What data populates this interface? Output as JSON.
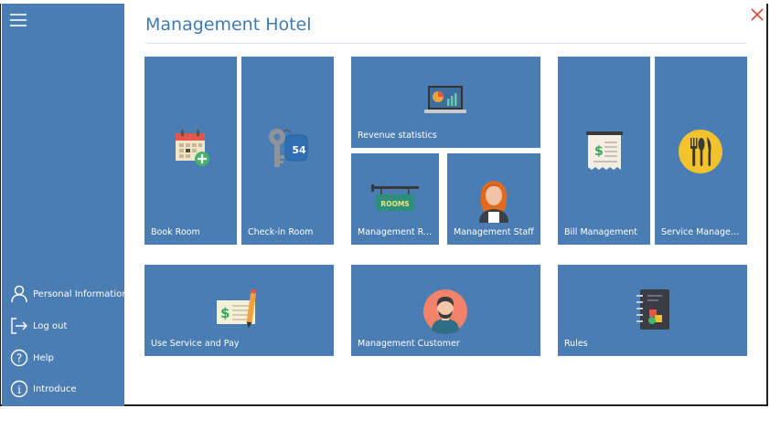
{
  "app": {
    "title": "Management Hotel"
  },
  "sidebar": {
    "menu_icon": "hamburger-icon",
    "items": [
      {
        "label": "Personal Information",
        "icon": "user-icon"
      },
      {
        "label": "Log out",
        "icon": "logout-icon"
      },
      {
        "label": "Help",
        "icon": "help-icon"
      },
      {
        "label": "Introduce",
        "icon": "info-icon"
      }
    ]
  },
  "window": {
    "close_icon": "close-icon"
  },
  "tiles": [
    {
      "label": "Book Room",
      "icon": "calendar-add-icon"
    },
    {
      "label": "Check-in Room",
      "icon": "room-key-icon",
      "key_number": "54"
    },
    {
      "label": "Revenue statistics",
      "icon": "laptop-chart-icon"
    },
    {
      "label": "Management Ro...",
      "icon": "rooms-sign-icon",
      "sign_text": "ROOMS"
    },
    {
      "label": "Management Staff",
      "icon": "staff-icon"
    },
    {
      "label": "Bill Management",
      "icon": "bill-icon"
    },
    {
      "label": "Service Managem...",
      "icon": "cutlery-icon"
    },
    {
      "label": "Use Service and Pay",
      "icon": "cheque-pencil-icon"
    },
    {
      "label": "Management Customer",
      "icon": "customer-icon"
    },
    {
      "label": "Rules",
      "icon": "notebook-icon"
    }
  ],
  "colors": {
    "tile": "#4a7db4",
    "sidebar": "#4a7db4",
    "title": "#3f7ab5",
    "close": "#e0453a"
  }
}
